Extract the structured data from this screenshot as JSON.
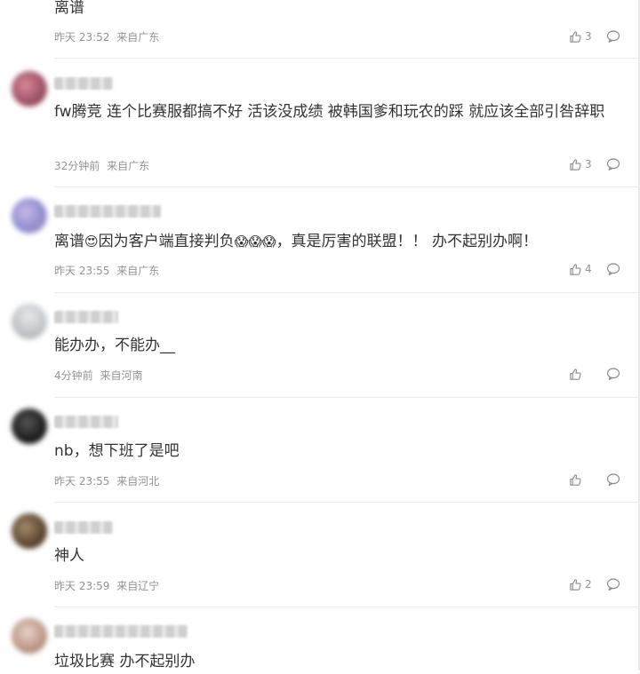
{
  "comments": [
    {
      "text": "离谱",
      "time": "昨天 23:52",
      "location": "来自广东",
      "likes": "3"
    },
    {
      "text": "fw腾竞 连个比赛服都搞不好 活该没成绩 被韩国爹和玩农的踩 就应该全部引咎辞职",
      "time": "32分钟前",
      "location": "来自广东",
      "likes": "3"
    },
    {
      "text_a": "离谱",
      "emoji_a": "😍",
      "text_b": "因为客户端直接判负",
      "emoji_b": "😱😱😱",
      "text_c": "，真是厉害的联盟！！ 办不起别办啊！",
      "time": "昨天 23:55",
      "location": "来自广东",
      "likes": "4"
    },
    {
      "text": "能办办，不能办__",
      "time": "4分钟前",
      "location": "来自河南",
      "likes": ""
    },
    {
      "text": "nb，想下班了是吧",
      "time": "昨天 23:55",
      "location": "来自河北",
      "likes": ""
    },
    {
      "text": "神人",
      "time": "昨天 23:59",
      "location": "来自辽宁",
      "likes": "2"
    },
    {
      "text": "垃圾比赛 办不起别办",
      "time": "",
      "location": "",
      "likes": ""
    }
  ],
  "icons": {
    "like": "thumbs-up-icon",
    "reply": "comment-bubble-icon"
  }
}
